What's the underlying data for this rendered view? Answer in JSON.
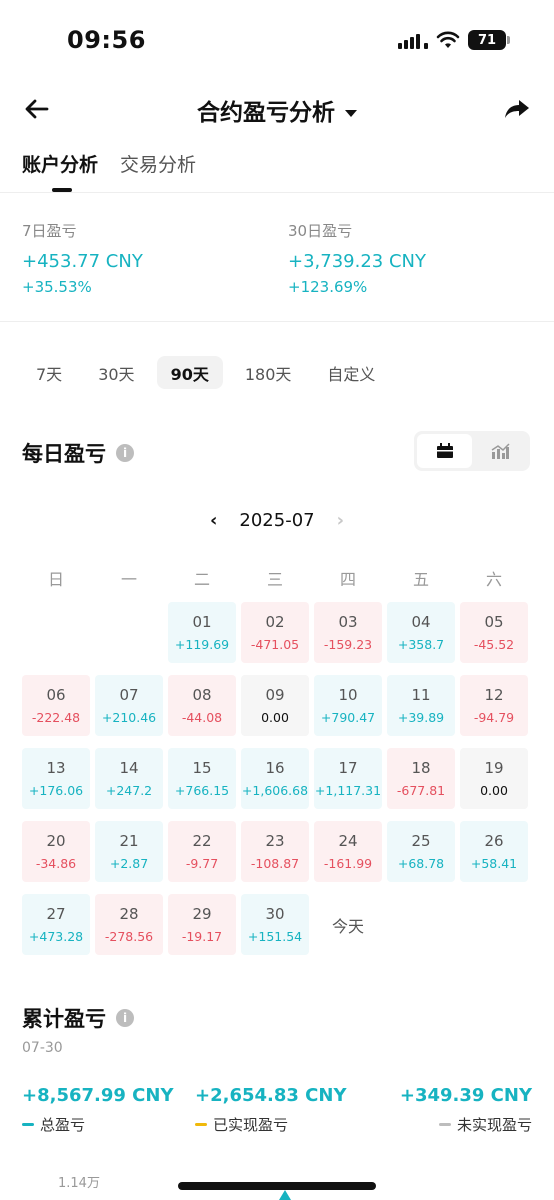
{
  "status": {
    "time": "09:56",
    "battery": "71"
  },
  "nav": {
    "title": "合约盈亏分析"
  },
  "tabs": [
    {
      "label": "账户分析",
      "active": true
    },
    {
      "label": "交易分析",
      "active": false
    }
  ],
  "stats": {
    "d7": {
      "label": "7日盈亏",
      "value": "+453.77 CNY",
      "pct": "+35.53%"
    },
    "d30": {
      "label": "30日盈亏",
      "value": "+3,739.23 CNY",
      "pct": "+123.69%"
    }
  },
  "ranges": [
    {
      "label": "7天",
      "active": false
    },
    {
      "label": "30天",
      "active": false
    },
    {
      "label": "90天",
      "active": true
    },
    {
      "label": "180天",
      "active": false
    },
    {
      "label": "自定义",
      "active": false
    }
  ],
  "daily": {
    "title": "每日盈亏",
    "info": "i"
  },
  "calendar": {
    "month": "2025-07",
    "prev": "‹",
    "next": "›",
    "weekdays": [
      "日",
      "一",
      "二",
      "三",
      "四",
      "五",
      "六"
    ],
    "today_label": "今天",
    "days": [
      {
        "day": "01",
        "value": "+119.69",
        "state": "pos"
      },
      {
        "day": "02",
        "value": "-471.05",
        "state": "neg"
      },
      {
        "day": "03",
        "value": "-159.23",
        "state": "neg"
      },
      {
        "day": "04",
        "value": "+358.7",
        "state": "pos"
      },
      {
        "day": "05",
        "value": "-45.52",
        "state": "neg"
      },
      {
        "day": "06",
        "value": "-222.48",
        "state": "neg"
      },
      {
        "day": "07",
        "value": "+210.46",
        "state": "pos"
      },
      {
        "day": "08",
        "value": "-44.08",
        "state": "neg"
      },
      {
        "day": "09",
        "value": "0.00",
        "state": "zero"
      },
      {
        "day": "10",
        "value": "+790.47",
        "state": "pos"
      },
      {
        "day": "11",
        "value": "+39.89",
        "state": "pos"
      },
      {
        "day": "12",
        "value": "-94.79",
        "state": "neg"
      },
      {
        "day": "13",
        "value": "+176.06",
        "state": "pos"
      },
      {
        "day": "14",
        "value": "+247.2",
        "state": "pos"
      },
      {
        "day": "15",
        "value": "+766.15",
        "state": "pos"
      },
      {
        "day": "16",
        "value": "+1,606.68",
        "state": "pos"
      },
      {
        "day": "17",
        "value": "+1,117.31",
        "state": "pos"
      },
      {
        "day": "18",
        "value": "-677.81",
        "state": "neg"
      },
      {
        "day": "19",
        "value": "0.00",
        "state": "zero"
      },
      {
        "day": "20",
        "value": "-34.86",
        "state": "neg"
      },
      {
        "day": "21",
        "value": "+2.87",
        "state": "pos"
      },
      {
        "day": "22",
        "value": "-9.77",
        "state": "neg"
      },
      {
        "day": "23",
        "value": "-108.87",
        "state": "neg"
      },
      {
        "day": "24",
        "value": "-161.99",
        "state": "neg"
      },
      {
        "day": "25",
        "value": "+68.78",
        "state": "pos"
      },
      {
        "day": "26",
        "value": "+58.41",
        "state": "pos"
      },
      {
        "day": "27",
        "value": "+473.28",
        "state": "pos"
      },
      {
        "day": "28",
        "value": "-278.56",
        "state": "neg"
      },
      {
        "day": "29",
        "value": "-19.17",
        "state": "neg"
      },
      {
        "day": "30",
        "value": "+151.54",
        "state": "pos"
      }
    ]
  },
  "cumulative": {
    "title": "累计盈亏",
    "info": "i",
    "date": "07-30",
    "total": {
      "value": "+8,567.99 CNY",
      "label": "总盈亏",
      "color": "#17b3c1"
    },
    "realized": {
      "value": "+2,654.83 CNY",
      "label": "已实现盈亏",
      "color": "#f0b90b"
    },
    "unrealized": {
      "value": "+349.39 CNY",
      "label": "未实现盈亏",
      "color": "#bdbdbd"
    }
  },
  "chart_axis": {
    "top_label": "1.14万"
  },
  "colors": {
    "positive": "#17b3c1",
    "negative": "#e5505f"
  }
}
